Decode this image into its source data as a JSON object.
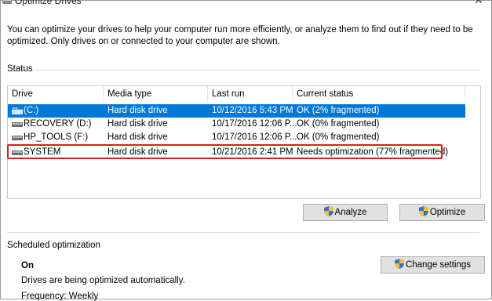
{
  "window": {
    "title": "Optimize Drives",
    "close_glyph": "✕"
  },
  "description": "You can optimize your drives to help your computer run more efficiently, or analyze them to find out if they need to be optimized. Only drives on or connected to your computer are shown.",
  "status_label": "Status",
  "table": {
    "headers": [
      "Drive",
      "Media type",
      "Last run",
      "Current status"
    ],
    "rows": [
      {
        "drive": "(C:)",
        "media": "Hard disk drive",
        "last_run": "10/12/2016 5:43 PM",
        "status": "OK (2% fragmented)",
        "icon": "windows-drive-icon",
        "selected": true
      },
      {
        "drive": "RECOVERY (D:)",
        "media": "Hard disk drive",
        "last_run": "10/17/2016 12:06 P...",
        "status": "OK (0% fragmented)",
        "icon": "drive-icon",
        "selected": false
      },
      {
        "drive": "HP_TOOLS (F:)",
        "media": "Hard disk drive",
        "last_run": "10/17/2016 12:06 P...",
        "status": "OK (0% fragmented)",
        "icon": "drive-icon",
        "selected": false
      },
      {
        "drive": "SYSTEM",
        "media": "Hard disk drive",
        "last_run": "10/21/2016 2:41 PM",
        "status": "Needs optimization (77% fragmented)",
        "icon": "drive-icon",
        "selected": false
      }
    ]
  },
  "buttons": {
    "analyze": "Analyze",
    "optimize": "Optimize",
    "change_settings": "Change settings"
  },
  "scheduled": {
    "label": "Scheduled optimization",
    "state": "On",
    "note": "Drives are being optimized automatically.",
    "frequency": "Frequency: Weekly"
  },
  "colors": {
    "selection": "#0078d7",
    "highlight_border": "#e01b1b"
  }
}
